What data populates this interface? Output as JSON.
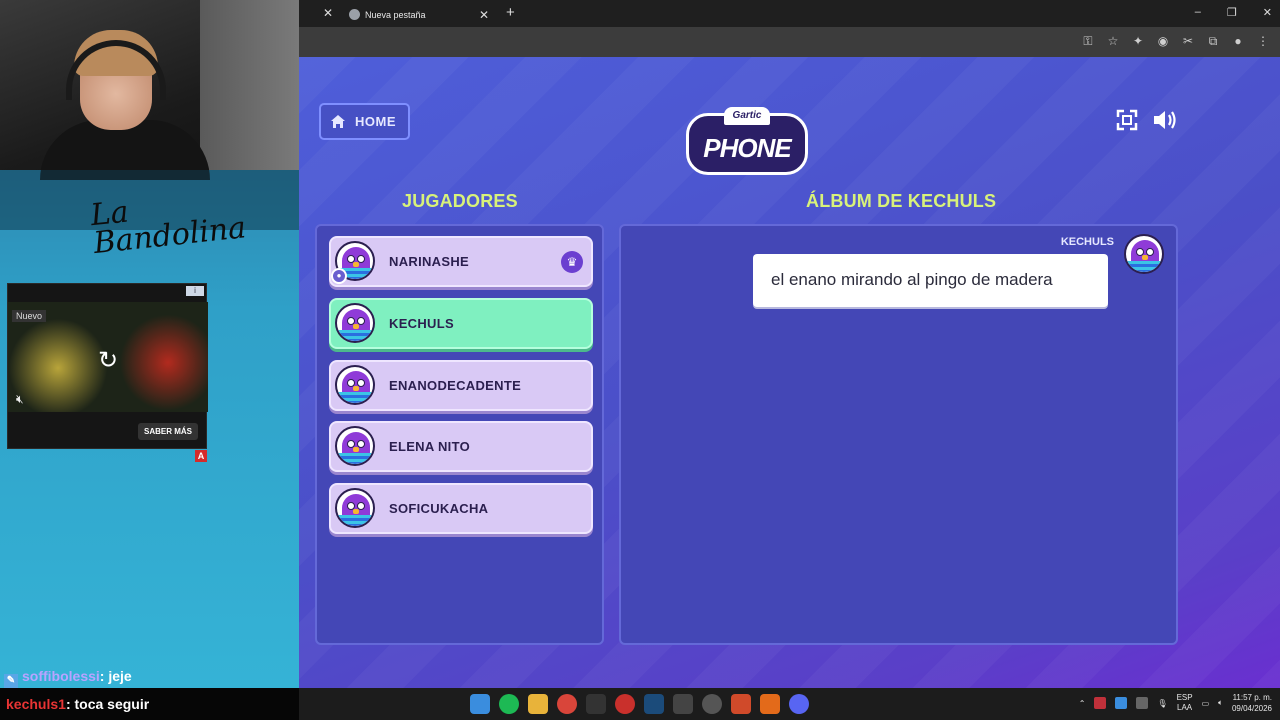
{
  "stream": {
    "logo_text": "La Bandolina",
    "ad": {
      "badge": "Nuevo",
      "cta": "SABER MÁS",
      "ad_mark": "A"
    },
    "chat": [
      {
        "user": "soffibolessi",
        "message": ": jeje"
      },
      {
        "user": "kechuls1",
        "message": ": toca seguir"
      }
    ]
  },
  "browser": {
    "tab": {
      "title": "Nueva pestaña"
    },
    "window_controls": [
      "–",
      "❐",
      "✕"
    ]
  },
  "game": {
    "home_label": "HOME",
    "logo": {
      "small": "Gartic",
      "big": "PHONE"
    },
    "players_title": "JUGADORES",
    "album_title": "ÁLBUM DE KECHULS",
    "players": [
      {
        "name": "NARINASHE",
        "host": true,
        "active": false
      },
      {
        "name": "KECHULS",
        "host": false,
        "active": true
      },
      {
        "name": "ENANODECADENTE",
        "host": false,
        "active": false
      },
      {
        "name": "ELENA NITO",
        "host": false,
        "active": false
      },
      {
        "name": "SOFICUKACHA",
        "host": false,
        "active": false
      }
    ],
    "album": {
      "author": "KECHULS",
      "phrase": "el enano mirando al pingo de madera"
    },
    "colors": {
      "accent_title": "#d8f27a",
      "active_player": "#7ff0c0",
      "player_card": "#d9c9f5"
    }
  },
  "taskbar": {
    "lang_top": "ESP",
    "lang_bottom": "LAA",
    "time": "11:57 p. m.",
    "date": "09/04/2026"
  }
}
